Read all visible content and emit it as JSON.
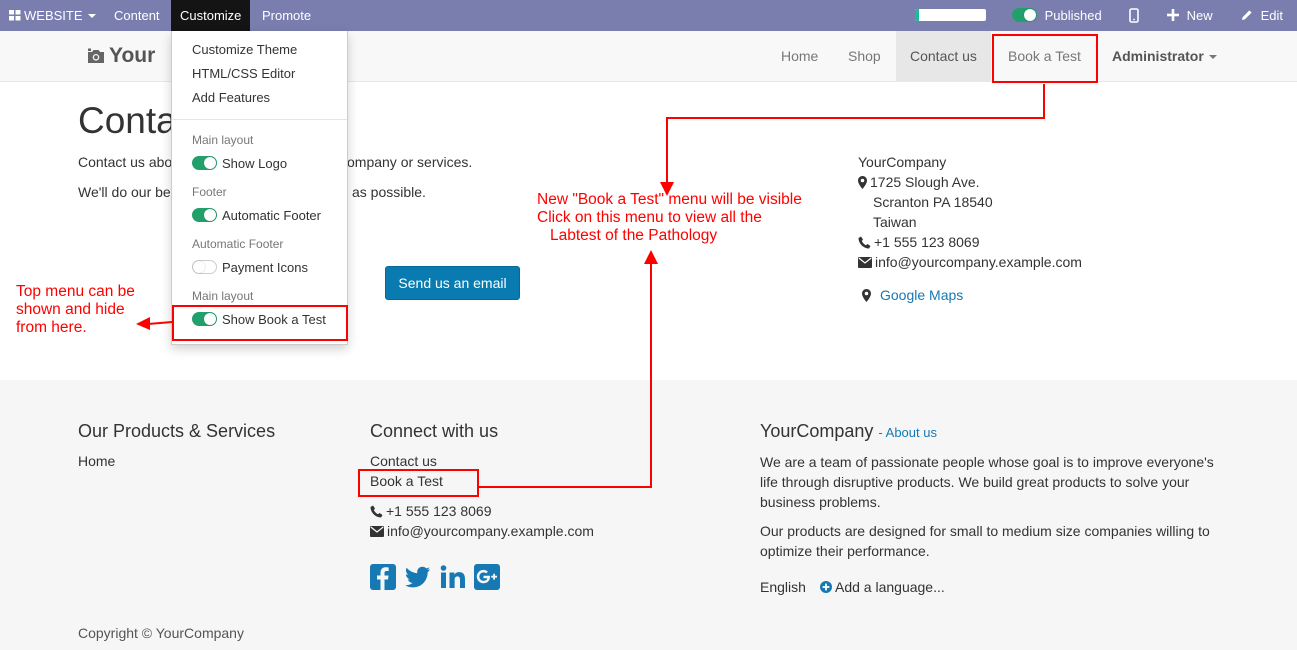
{
  "adminbar": {
    "website_label": "WEBSITE",
    "content_label": "Content",
    "customize_label": "Customize",
    "promote_label": "Promote",
    "published_label": "Published",
    "new_label": "New",
    "edit_label": "Edit",
    "progress": 0.05
  },
  "header": {
    "logo_text": "Your",
    "nav": [
      "Home",
      "Shop",
      "Contact us",
      "Book a Test",
      "Administrator"
    ]
  },
  "customize_menu": {
    "items": [
      "Customize Theme",
      "HTML/CSS Editor",
      "Add Features"
    ],
    "sections": [
      {
        "header": "Main layout",
        "toggle_label": "Show Logo",
        "on": true
      },
      {
        "header": "Footer",
        "toggle_label": "Automatic Footer",
        "on": true
      },
      {
        "header": "Automatic Footer",
        "toggle_label": "Payment Icons",
        "on": false
      },
      {
        "header": "Main layout",
        "toggle_label": "Show Book a Test",
        "on": true
      }
    ]
  },
  "main": {
    "title": "Conta",
    "line1_left": "Contact us abo",
    "line1_right": "ompany or services.",
    "line2_left": "We'll do our be",
    "line2_right": "as possible.",
    "email_button": "Send us an email",
    "company": {
      "name": "YourCompany",
      "street": "1725 Slough Ave.",
      "city": "Scranton PA 18540",
      "country": "Taiwan",
      "phone": "+1 555 123 8069",
      "email": "info@yourcompany.example.com",
      "maps": "Google Maps"
    }
  },
  "annotations": {
    "book_note_1": "New \"Book a Test\" menu will be visible",
    "book_note_2": "Click on this menu to view all the",
    "book_note_3": "Labtest of the Pathology",
    "menu_note_1": "Top menu can be",
    "menu_note_2": "shown and hide",
    "menu_note_3": "from here."
  },
  "footer": {
    "products_heading": "Our Products & Services",
    "products_link": "Home",
    "connect_heading": "Connect with us",
    "connect_links": [
      "Contact us",
      "Book a Test"
    ],
    "phone": "+1 555 123 8069",
    "email": "info@yourcompany.example.com",
    "about_company": "YourCompany",
    "about_link": "- About us",
    "about_p1": "We are a team of passionate people whose goal is to improve everyone's life through disruptive products. We build great products to solve your business problems.",
    "about_p2": "Our products are designed for small to medium size companies willing to optimize their performance.",
    "language": "English",
    "add_language": "Add a language...",
    "copyright": "Copyright © YourCompany"
  },
  "colors": {
    "adminbar": "#7a7eae",
    "link": "#1779b3",
    "button": "#0a7bb0",
    "annotation": "#ff0000",
    "toggle_on": "#22a06b"
  },
  "icons": {
    "apps": "apps-icon",
    "new": "plus-icon",
    "edit": "pencil-icon",
    "mobile": "mobile-icon",
    "marker": "map-marker-icon",
    "phone": "phone-icon",
    "envelope": "envelope-icon",
    "social": [
      "facebook-icon",
      "twitter-icon",
      "linkedin-icon",
      "google-plus-icon"
    ]
  }
}
